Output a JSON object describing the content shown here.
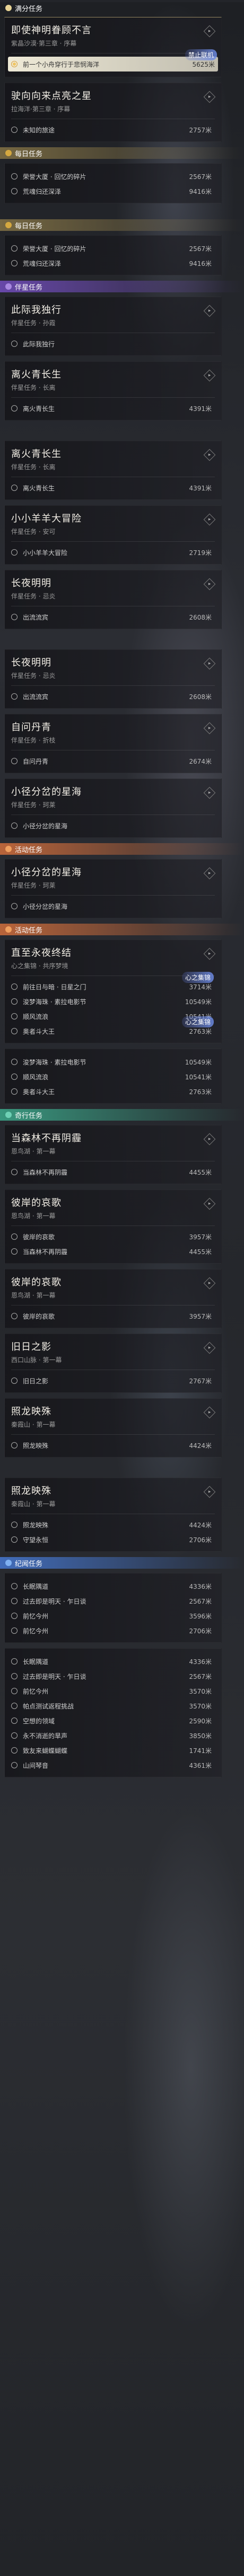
{
  "cat_main": "满分任务",
  "cat_daily": "每日任务",
  "cat_companion": "伴星任务",
  "cat_event": "活动任务",
  "cat_adventure": "奇行任务",
  "cat_memory": "纪闻任务",
  "q1": {
    "title": "即使神明眷顾不言",
    "sub": "紫晶沙漠·第三章 · 序幕",
    "obj1": "前一个小舟穿行于悲悯海洋",
    "dist1": "5625米",
    "badge": "禁止联机"
  },
  "q2": {
    "title": "驶向向来点亮之星",
    "sub": "拉海洋·第三章 · 序幕",
    "obj1": "未知的旅途",
    "dist1": "2757米"
  },
  "d1": {
    "title": "每日任务",
    "obj1": "荣誉大厦 · 回忆的碎片",
    "dist1": "2567米",
    "obj2": "荒魂归还深泽",
    "dist2": "9416米"
  },
  "d2": {
    "title": "每日任务",
    "obj1": "荣誉大厦 · 回忆的碎片",
    "dist1": "2567米",
    "obj2": "荒魂归还深泽",
    "dist2": "9416米"
  },
  "c1": {
    "title": "此际我独行",
    "sub": "伴星任务 · 孙霞",
    "obj1": "此际我独行"
  },
  "c2": {
    "title": "离火青长生",
    "sub": "伴星任务 · 长离",
    "obj1": "离火青长生",
    "dist1": "4391米"
  },
  "c3": {
    "title": "离火青长生",
    "sub": "伴星任务 · 长离",
    "obj1": "离火青长生",
    "dist1": "4391米"
  },
  "c4": {
    "title": "小小羊羊大冒险",
    "sub": "伴星任务 · 安可",
    "obj1": "小小羊羊大冒险",
    "dist1": "2719米"
  },
  "c5": {
    "title": "长夜明明",
    "sub": "伴星任务 · 忌炎",
    "obj1": "出流流宾",
    "dist1": "2608米"
  },
  "c6": {
    "title": "长夜明明",
    "sub": "伴星任务 · 忌炎",
    "obj1": "出流流宾",
    "dist1": "2608米"
  },
  "c7": {
    "title": "自问丹青",
    "sub": "伴星任务 · 折枝",
    "obj1": "自问丹青",
    "dist1": "2674米"
  },
  "c8": {
    "title": "小径分岔的星海",
    "sub": "伴星任务 · 珂莱",
    "obj1": "小径分岔的星海"
  },
  "e1": {
    "title": "小径分岔的星海",
    "sub": "伴星任务 · 珂莱",
    "obj1": "小径分岔的星海"
  },
  "e2": {
    "title": "直至永夜终结",
    "sub": "心之集锦 · 共序梦境",
    "obj1": "前往日与暗 · 日星之门",
    "dist1": "3714米",
    "badge": "心之集锦",
    "obj2": "浚梦海珠 · 素拉电影节",
    "dist2": "10549米",
    "obj3": "顺风流浪",
    "dist3": "10541米",
    "obj4": "奥者斗大王",
    "dist4": "2763米",
    "badge2": "心之集锦"
  },
  "e3": {
    "obj1": "浚梦海珠 · 素拉电影节",
    "dist1": "10549米",
    "obj2": "顺风流浪",
    "dist2": "10541米",
    "obj3": "奥者斗大王",
    "dist3": "2763米"
  },
  "a1": {
    "title": "当森林不再阴霾",
    "sub": "恩鸟湖 · 第一幕",
    "obj1": "当森林不再阴霾",
    "dist1": "4455米"
  },
  "a2": {
    "title": "彼岸的哀歌",
    "sub": "恩鸟湖 · 第一幕",
    "obj1": "彼岸的哀歌",
    "dist1": "3957米",
    "obj2": "当森林不再阴霾",
    "dist2": "4455米"
  },
  "a3": {
    "title": "彼岸的哀歌",
    "sub": "恩鸟湖 · 第一幕",
    "obj1": "彼岸的哀歌",
    "dist1": "3957米"
  },
  "a4": {
    "title": "旧日之影",
    "sub": "西口山脉 · 第一幕",
    "obj1": "旧日之影",
    "dist1": "2767米"
  },
  "a5": {
    "title": "照龙映殊",
    "sub": "秦霞山 · 第一幕",
    "obj1": "照龙映殊",
    "dist1": "4424米"
  },
  "a6": {
    "title": "照龙映殊",
    "sub": "秦霞山 · 第一幕",
    "obj1": "照龙映殊",
    "dist1": "4424米",
    "obj2": "守望永恒",
    "dist2": "2706米"
  },
  "m1": {
    "obj1": "长眠隅道",
    "dist1": "4336米",
    "obj2": "过去即是明天 · 乍日谈",
    "dist2": "2567米",
    "obj3": "前忆今州",
    "dist3": "3596米",
    "obj4": "前忆今州",
    "dist4": "2706米",
    "obj5": "长眠隅道",
    "dist5": "4336米",
    "obj6": "过去即是明天 · 乍日谈",
    "dist6": "2567米",
    "obj7": "前忆今州",
    "dist7": "3570米",
    "obj8": "帕点测试返程挑战",
    "dist8": "3570米",
    "obj9": "空想的领域",
    "dist9": "2590米",
    "obj10": "永不消逝的旱声",
    "dist10": "3850米",
    "obj11": "致友来蝴蝶蝴蝶",
    "dist11": "1741米",
    "obj12": "山间琴音",
    "dist12": "4361米"
  }
}
